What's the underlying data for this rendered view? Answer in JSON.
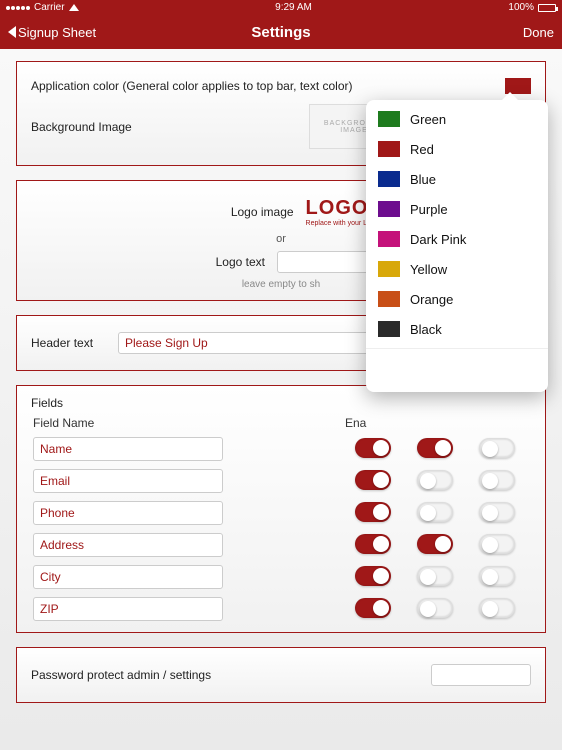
{
  "status": {
    "carrier": "Carrier",
    "time": "9:29 AM",
    "battery": "100%"
  },
  "nav": {
    "back": "Signup Sheet",
    "title": "Settings",
    "done": "Done"
  },
  "appColor": {
    "label": "Application color (General color applies to top bar, text color)",
    "value": "#a01818"
  },
  "bgImage": {
    "label": "Background Image",
    "thumb1": "BACKGROUND",
    "thumb2": "IMAGE"
  },
  "logo": {
    "imgLabel": "Logo image",
    "logoText": "LOGO",
    "logoSub": "Replace with your L",
    "or": "or",
    "txtLabel": "Logo text",
    "hint": "leave empty to sh"
  },
  "header": {
    "label": "Header text",
    "value": "Please Sign Up"
  },
  "fieldsPanel": {
    "title": "Fields",
    "colName": "Field Name",
    "colEnable": "Ena"
  },
  "fields": [
    {
      "name": "Name",
      "c1": true,
      "c2": true,
      "c3": false
    },
    {
      "name": "Email",
      "c1": true,
      "c2": false,
      "c3": false
    },
    {
      "name": "Phone",
      "c1": true,
      "c2": false,
      "c3": false
    },
    {
      "name": "Address",
      "c1": true,
      "c2": true,
      "c3": false
    },
    {
      "name": "City",
      "c1": true,
      "c2": false,
      "c3": false
    },
    {
      "name": "ZIP",
      "c1": true,
      "c2": false,
      "c3": false
    }
  ],
  "password": {
    "label": "Password protect admin / settings"
  },
  "colorOptions": [
    {
      "name": "Green",
      "hex": "#1e7b1e"
    },
    {
      "name": "Red",
      "hex": "#a01818"
    },
    {
      "name": "Blue",
      "hex": "#0a2b8e"
    },
    {
      "name": "Purple",
      "hex": "#6d0d8e"
    },
    {
      "name": "Dark Pink",
      "hex": "#c4127a"
    },
    {
      "name": "Yellow",
      "hex": "#d8a80a"
    },
    {
      "name": "Orange",
      "hex": "#c84f17"
    },
    {
      "name": "Black",
      "hex": "#2a2a2a"
    }
  ]
}
